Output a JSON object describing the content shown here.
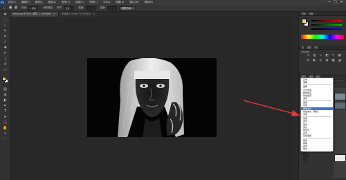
{
  "app": {
    "logo": "Ps"
  },
  "menubar": {
    "items": [
      "文件(F)",
      "编辑(E)",
      "图像(I)",
      "图层(L)",
      "类型(Y)",
      "选择(S)",
      "滤镜(T)",
      "3D(D)",
      "视图(V)",
      "窗口(W)",
      "帮助(H)"
    ],
    "controls": [
      "—",
      "□",
      "✕"
    ]
  },
  "options_bar": {
    "feather_label": "羽化:",
    "feather_value": "0 像素",
    "antialias_label": "消除锯齿",
    "style_label": "样式:",
    "style_value": "正常",
    "width_label": "宽度:",
    "height_label": "高度:",
    "refine_button": "调整边缘..."
  },
  "doc_tabs": [
    {
      "title": "timg.jpg @ 50% (图层 1, RGB/8#)",
      "close": "×",
      "active": true
    },
    {
      "title": "未标题-1 @ 66.7% (RGB/8)",
      "close": "×",
      "active": false
    }
  ],
  "panels": {
    "color_tabs": [
      "颜色",
      "色板"
    ],
    "adjust_tabs": [
      "库",
      "调整",
      "样式"
    ],
    "adjust_title": "添加调整",
    "layers_tabs": [
      "图层",
      "通道",
      "路径"
    ],
    "kind_label": "类型",
    "blend_value": "正常",
    "opacity_label": "不透明度:",
    "opacity_value": "100%",
    "fill_label": "填充:",
    "fill_value": "100%"
  },
  "blend_dropdown": {
    "selected": "颜色减淡",
    "groups": [
      [
        "正常",
        "溶解"
      ],
      [
        "变暗",
        "正片叠底",
        "颜色加深",
        "线性加深",
        "深色"
      ],
      [
        "变亮",
        "滤色",
        "颜色减淡",
        "线性减淡（添加）",
        "浅色"
      ],
      [
        "叠加",
        "柔光",
        "强光",
        "亮光",
        "线性光",
        "点光",
        "实色混合"
      ],
      [
        "差值",
        "排除",
        "减去",
        "划分"
      ],
      [
        "色相",
        "饱和度",
        "颜色",
        "明度"
      ]
    ]
  },
  "colors": {
    "foreground": "#f0d67a",
    "background": "#ffffff",
    "accent": "#3b74d6",
    "annotation_arrow": "#e53935"
  },
  "tools": [
    "move-icon",
    "marquee-icon",
    "lasso-icon",
    "quick-select-icon",
    "crop-icon",
    "eyedropper-icon",
    "healing-icon",
    "brush-icon",
    "stamp-icon",
    "history-brush-icon",
    "eraser-icon",
    "gradient-icon",
    "blur-icon",
    "dodge-icon",
    "pen-icon",
    "type-icon",
    "path-select-icon",
    "shape-icon",
    "hand-icon",
    "zoom-icon",
    "more-icon"
  ]
}
